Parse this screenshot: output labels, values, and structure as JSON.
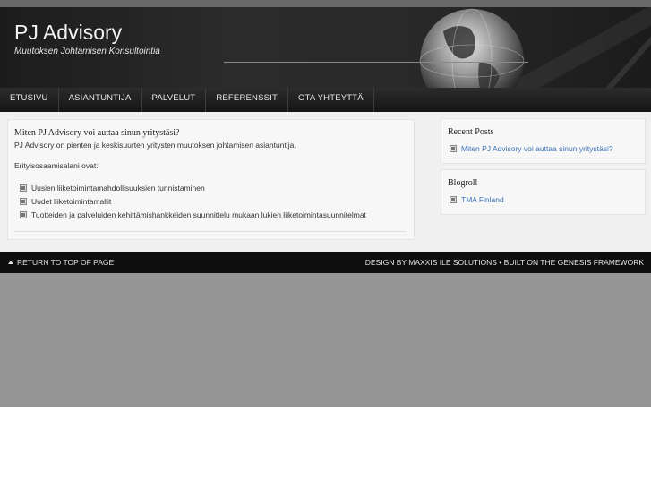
{
  "site": {
    "title": "PJ Advisory",
    "description": "Muutoksen Johtamisen Konsultointia"
  },
  "nav": {
    "items": [
      "ETUSIVU",
      "ASIANTUNTIJA",
      "PALVELUT",
      "REFERENSSIT",
      "OTA YHTEYTTÄ"
    ]
  },
  "post": {
    "title": "Miten PJ Advisory voi auttaa sinun yritystäsi?",
    "intro": "PJ Advisory on pienten ja keskisuurten yritysten muutoksen johtamisen asiantuntija.",
    "list_heading": "Erityisosaamisalani ovat:",
    "items": [
      "Uusien liiketoimintamahdollisuuksien tunnistaminen",
      "Uudet liiketoimintamallit",
      "Tuotteiden ja palveluiden kehittämishankkeiden suunnittelu mukaan lukien liiketoimintasuunnitelmat"
    ]
  },
  "sidebar": {
    "recent_posts": {
      "title": "Recent Posts",
      "link": "Miten PJ Advisory voi auttaa sinun yritystäsi?"
    },
    "blogroll": {
      "title": "Blogroll",
      "link": "TMA Finland"
    }
  },
  "footer": {
    "back_to_top": "RETURN TO TOP OF PAGE",
    "credits": "DESIGN BY MAXXIS ILE SOLUTIONS • BUILT ON THE GENESIS FRAMEWORK"
  },
  "colors": {
    "header_bg": "#1c1c1c",
    "link": "#3a73b8",
    "page_bg": "#959595"
  }
}
